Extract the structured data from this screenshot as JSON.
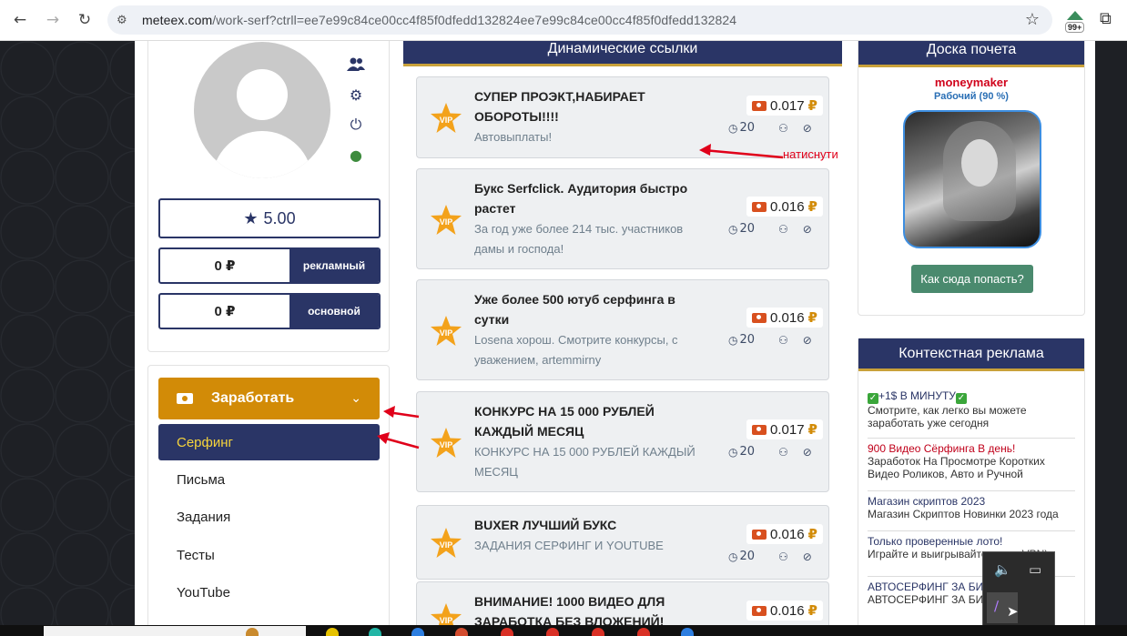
{
  "browser": {
    "url_host": "meteex.com",
    "url_path": "/work-serf?ctrll=ee7e99c84ce00cc4f85f0dfedd132824ee7e99c84ce00cc4f85f0dfedd132824",
    "extension_badge": "99+"
  },
  "profile": {
    "rating": "5.00",
    "balances": [
      {
        "amount": "0 ₽",
        "label": "рекламный"
      },
      {
        "amount": "0 ₽",
        "label": "основной"
      }
    ]
  },
  "menu": {
    "earn_label": "Заработать",
    "items": [
      {
        "label": "Серфинг",
        "active": true
      },
      {
        "label": "Письма",
        "active": false
      },
      {
        "label": "Задания",
        "active": false
      },
      {
        "label": "Тесты",
        "active": false
      },
      {
        "label": "YouTube",
        "active": false
      }
    ]
  },
  "center": {
    "heading": "Динамические ссылки",
    "vip_label": "VIP",
    "links": [
      {
        "title": "СУПЕР ПРОЭКТ,НАБИРАЕТ ОБОРОТЫ!!!!",
        "desc": "Автовыплаты!",
        "price": "0.017",
        "currency": "₽",
        "views": "20"
      },
      {
        "title": "Букс Serfclick. Аудитория быстро растет",
        "desc": "За год уже более 214 тыс. участников дамы и господа!",
        "price": "0.016",
        "currency": "₽",
        "views": "20"
      },
      {
        "title": "Уже более 500 ютуб серфинга в сутки",
        "desc": "Losena хорош. Смотрите конкурсы, с уважением, artemmirny",
        "price": "0.016",
        "currency": "₽",
        "views": "20"
      },
      {
        "title": "КОНКУРС НА 15 000 РУБЛЕЙ КАЖДЫЙ МЕСЯЦ",
        "desc": "КОНКУРС НА 15 000 РУБЛЕЙ КАЖДЫЙ МЕСЯЦ",
        "price": "0.017",
        "currency": "₽",
        "views": "20"
      },
      {
        "title": "BUXER ЛУЧШИЙ БУКС",
        "desc": "ЗАДАНИЯ СЕРФИНГ И YOUTUBE",
        "price": "0.016",
        "currency": "₽",
        "views": "20"
      },
      {
        "title": "ВНИМАНИЕ! 1000 ВИДЕО ДЛЯ ЗАРАБОТКА БЕЗ ВЛОЖЕНИЙ!",
        "desc": "",
        "price": "0.016",
        "currency": "₽",
        "views": ""
      }
    ],
    "annotation": "натиснути"
  },
  "honor": {
    "heading": "Доска почета",
    "name": "moneymaker",
    "rank": "Рабочий (90 %)",
    "button": "Как сюда попасть?"
  },
  "context_ads": {
    "heading": "Контекстная реклама",
    "items": [
      {
        "title": "+1$ В МИНУТУ",
        "desc": "Смотрите, как легко вы можете заработать уже сегодня",
        "red": false
      },
      {
        "title": "900 Видео Сёрфинга В день!",
        "desc": "Заработок На Просмотре Коротких Видео Роликов, Авто и Ручной",
        "red": true
      },
      {
        "title": "Магазин скриптов 2023",
        "desc": "Магазин Скриптов Новинки 2023 года",
        "red": false
      },
      {
        "title": "Только проверенные лото!",
        "desc": "Играйте и выигрывайте через VPN)",
        "red": false
      },
      {
        "title": "АВТОСЕРФИНГ ЗА БИ",
        "desc": "АВТОСЕРФИНГ ЗА БИ",
        "red": false
      }
    ]
  },
  "colors": {
    "navy": "#2a3566",
    "orange": "#d28b07",
    "green_button": "#4a8a6e",
    "annotation_red": "#e0001a"
  }
}
